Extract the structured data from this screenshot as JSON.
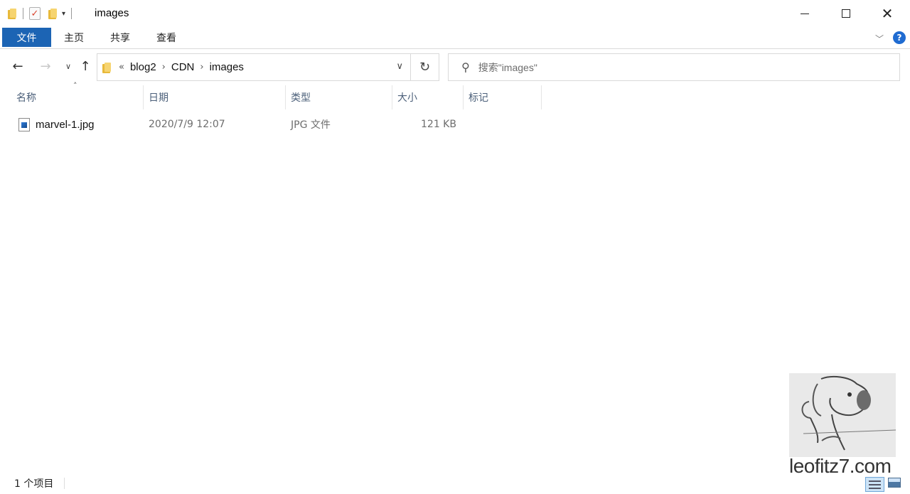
{
  "window": {
    "title": "images",
    "controls": {
      "minimize": "minimize-icon",
      "maximize": "maximize-icon",
      "close": "close-icon"
    }
  },
  "ribbon": {
    "tabs": [
      {
        "label": "文件",
        "active": true
      },
      {
        "label": "主页"
      },
      {
        "label": "共享"
      },
      {
        "label": "查看"
      }
    ],
    "help_label": "?"
  },
  "address_bar": {
    "overflow_glyph": "«",
    "breadcrumbs": [
      "blog2",
      "CDN",
      "images"
    ]
  },
  "search": {
    "placeholder": "搜索\"images\""
  },
  "columns": [
    "名称",
    "日期",
    "类型",
    "大小",
    "标记"
  ],
  "files": [
    {
      "name": "marvel-1.jpg",
      "date": "2020/7/9 12:07",
      "type": "JPG 文件",
      "size": "121 KB",
      "tag": ""
    }
  ],
  "status": {
    "item_count": "1 个项目"
  },
  "watermark": {
    "text": "leofitz7.com"
  },
  "colors": {
    "accent": "#1c64b4",
    "header_text": "#4c607a",
    "help": "#1f6bd1"
  }
}
